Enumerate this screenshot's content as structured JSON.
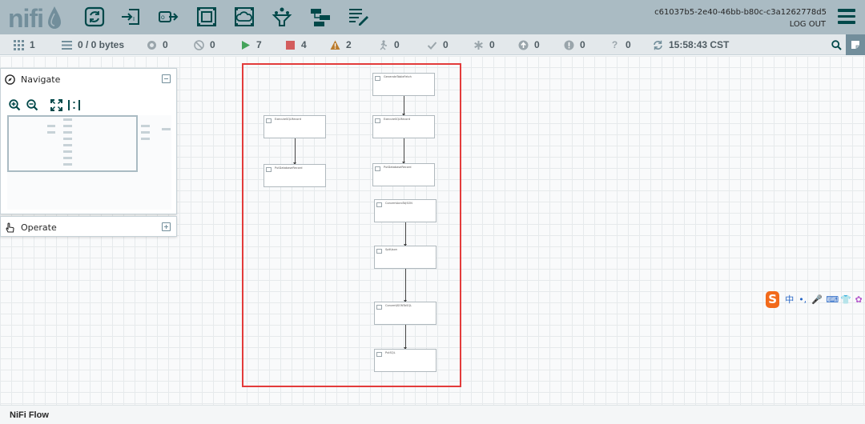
{
  "header": {
    "logo": "nifi",
    "user_id": "c61037b5-2e40-46bb-b80c-c3a1262778d5",
    "logout_label": "LOG OUT",
    "brand_color": "#004849",
    "toolbar": [
      {
        "icon": "processor-icon"
      },
      {
        "icon": "input-port-icon"
      },
      {
        "icon": "output-port-icon"
      },
      {
        "icon": "process-group-icon"
      },
      {
        "icon": "remote-process-group-icon"
      },
      {
        "icon": "funnel-icon"
      },
      {
        "icon": "template-icon"
      },
      {
        "icon": "label-icon"
      }
    ]
  },
  "status": {
    "transmitting": "1",
    "queued": "0 / 0 bytes",
    "remote_transmitting": "0",
    "remote_not_transmitting": "0",
    "running": "7",
    "stopped": "4",
    "invalid": "2",
    "disabled": "0",
    "up_to_date": "0",
    "locally_modified": "0",
    "stale": "0",
    "sync_failure": "0",
    "unknown": "0",
    "last_refresh": "15:58:43 CST"
  },
  "navigate_panel": {
    "title": "Navigate"
  },
  "operate_panel": {
    "title": "Operate"
  },
  "processors": [
    {
      "name": "GenerateTableFetch"
    },
    {
      "name": "ExecuteSQLRecord"
    },
    {
      "name": "PutDatabaseRecord"
    },
    {
      "name": "ExecuteSQLRecord"
    },
    {
      "name": "PutDatabaseRecord"
    },
    {
      "name": "ConvertAvroToJSON"
    },
    {
      "name": "SplitJson"
    },
    {
      "name": "ConvertJSONToSQL"
    },
    {
      "name": "PutSQL"
    }
  ],
  "ime": {
    "lang": "中",
    "punct": "•,",
    "mic": "🎤",
    "keyboard": "⌨",
    "skin": "👕",
    "tools": "✿"
  },
  "footer": {
    "breadcrumb": "NiFi Flow"
  }
}
